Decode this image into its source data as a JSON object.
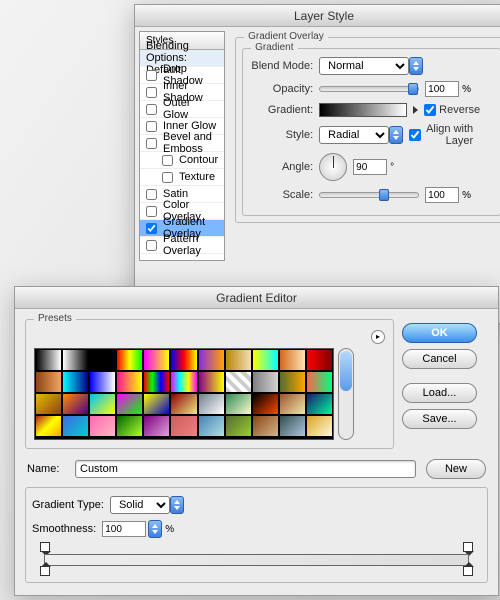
{
  "layer_style": {
    "title": "Layer Style",
    "styles_header": "Styles",
    "blending_default": "Blending Options: Default",
    "items": [
      {
        "label": "Drop Shadow",
        "checked": false
      },
      {
        "label": "Inner Shadow",
        "checked": false
      },
      {
        "label": "Outer Glow",
        "checked": false
      },
      {
        "label": "Inner Glow",
        "checked": false
      },
      {
        "label": "Bevel and Emboss",
        "checked": false
      },
      {
        "label": "Contour",
        "checked": false,
        "indent": true
      },
      {
        "label": "Texture",
        "checked": false,
        "indent": true
      },
      {
        "label": "Satin",
        "checked": false
      },
      {
        "label": "Color Overlay",
        "checked": false
      },
      {
        "label": "Gradient Overlay",
        "checked": true,
        "selected": true
      },
      {
        "label": "Pattern Overlay",
        "checked": false
      }
    ],
    "overlay_group": "Gradient Overlay",
    "gradient_group": "Gradient",
    "blend_mode_label": "Blend Mode:",
    "blend_mode_value": "Normal",
    "opacity_label": "Opacity:",
    "opacity_value": "100",
    "gradient_label": "Gradient:",
    "reverse_label": "Reverse",
    "reverse_checked": true,
    "style_label": "Style:",
    "style_value": "Radial",
    "align_label": "Align with Layer",
    "align_checked": true,
    "angle_label": "Angle:",
    "angle_value": "90",
    "angle_deg": "°",
    "scale_label": "Scale:",
    "scale_value": "100"
  },
  "gradient_editor": {
    "title": "Gradient Editor",
    "presets_label": "Presets",
    "ok": "OK",
    "cancel": "Cancel",
    "load": "Load...",
    "save": "Save...",
    "name_label": "Name:",
    "name_value": "Custom",
    "new_btn": "New",
    "type_label": "Gradient Type:",
    "type_value": "Solid",
    "smooth_label": "Smoothness:",
    "smooth_value": "100",
    "percent": "%",
    "preset_colors": [
      "linear-gradient(90deg,#000,#fff)",
      "linear-gradient(90deg,#fff,#fff0)",
      "linear-gradient(90deg,#000,#fff0)",
      "linear-gradient(90deg,#f00,#ff0,#0f0)",
      "linear-gradient(90deg,#f0f,#ff0)",
      "linear-gradient(90deg,#00f,#f00,#ff0)",
      "linear-gradient(90deg,#8a2be2,#ffa500)",
      "linear-gradient(90deg,#b8860b,#f5deb3)",
      "linear-gradient(90deg,#ff0,#0ff)",
      "linear-gradient(90deg,#d2691e,#ffe4b5)",
      "linear-gradient(90deg,#f00,#800000)",
      "linear-gradient(90deg,#8b4513,#f4a460)",
      "linear-gradient(90deg,#0ff,#00008b)",
      "linear-gradient(90deg,#00f,#fff)",
      "linear-gradient(90deg,#ff1493,#ff0)",
      "linear-gradient(90deg,#f00,#0f0,#00f,#f00)",
      "linear-gradient(90deg,#f0f,#0ff,#ff0,#f0f)",
      "linear-gradient(90deg,#8b008b,#ff0)",
      "repeating-linear-gradient(45deg,#ccc 0 4px,#fff 4px 8px)",
      "linear-gradient(90deg,#808080,#d3d3d3)",
      "linear-gradient(90deg,#556b2f,#ffa500)",
      "linear-gradient(90deg,#ff6347,#00ff7f)",
      "linear-gradient(135deg,#e6b800,#8b4513)",
      "linear-gradient(135deg,#ff8c00,#4b0082)",
      "linear-gradient(135deg,#00bfff,#ff0)",
      "linear-gradient(135deg,#f0f,#0f0)",
      "linear-gradient(135deg,#ff0,#0000cd)",
      "linear-gradient(135deg,#8b0000,#f0e68c)",
      "linear-gradient(135deg,#708090,#fff)",
      "linear-gradient(135deg,#2e8b57,#fffacd)",
      "linear-gradient(135deg,#000,#ff4500)",
      "linear-gradient(135deg,#a0522d,#eee8aa)",
      "linear-gradient(135deg,#191970,#00fa9a)",
      "linear-gradient(135deg,#b22222,#ff0,#ffa500)",
      "linear-gradient(135deg,#4169e1,#00ced1)",
      "linear-gradient(135deg,#ff69b4,#ffb6c1)",
      "linear-gradient(135deg,#006400,#adff2f)",
      "linear-gradient(135deg,#800080,#dda0dd)",
      "linear-gradient(135deg,#cd5c5c,#f08080)",
      "linear-gradient(135deg,#4682b4,#b0e0e6)",
      "linear-gradient(135deg,#556b2f,#9acd32)",
      "linear-gradient(135deg,#8b4513,#d2b48c)",
      "linear-gradient(135deg,#2f4f4f,#b0c4de)",
      "linear-gradient(135deg,#daa520,#fff8dc)"
    ]
  }
}
